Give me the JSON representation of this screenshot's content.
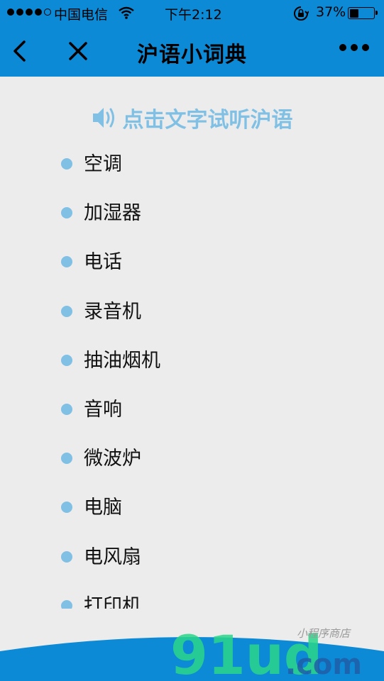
{
  "status_bar": {
    "carrier": "中国电信",
    "time": "下午2:12",
    "battery_percent": "37%",
    "battery_level": 0.37,
    "signal_bars_filled": 4,
    "signal_bars_total": 5
  },
  "nav": {
    "title": "沪语小词典"
  },
  "hint": "点击文字试听沪语",
  "words": [
    "空调",
    "加湿器",
    "电话",
    "录音机",
    "抽油烟机",
    "音响",
    "微波炉",
    "电脑",
    "电风扇",
    "打印机"
  ],
  "watermark": {
    "brand": "91ud",
    "domain": ".com",
    "tagline": "小程序商店"
  },
  "colors": {
    "header": "#0d8ad6",
    "accent": "#7fc0e4",
    "background": "#ececec",
    "watermark_green": "#2bd68a"
  },
  "icons": [
    "back-icon",
    "close-icon",
    "more-icon",
    "speaker-icon",
    "wifi-icon",
    "rotation-lock-icon",
    "battery-icon"
  ]
}
